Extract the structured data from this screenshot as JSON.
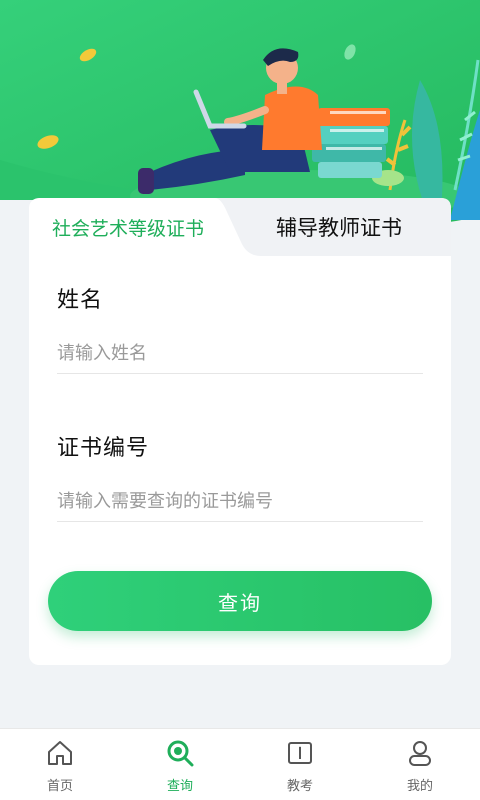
{
  "tabs": {
    "active_label": "社会艺术等级证书",
    "inactive_label": "辅导教师证书"
  },
  "form": {
    "name_label": "姓名",
    "name_placeholder": "请输入姓名",
    "cert_label": "证书编号",
    "cert_placeholder": "请输入需要查询的证书编号",
    "submit_label": "查询"
  },
  "bottom_nav": {
    "items": [
      {
        "label": "首页",
        "icon": "home-icon",
        "active": false
      },
      {
        "label": "查询",
        "icon": "search-icon",
        "active": true
      },
      {
        "label": "教考",
        "icon": "book-icon",
        "active": false
      },
      {
        "label": "我的",
        "icon": "user-icon",
        "active": false
      }
    ]
  },
  "colors": {
    "brand_green": "#1fae5a",
    "hero_green": "#2dc56e",
    "page_bg": "#f0f3f6"
  }
}
